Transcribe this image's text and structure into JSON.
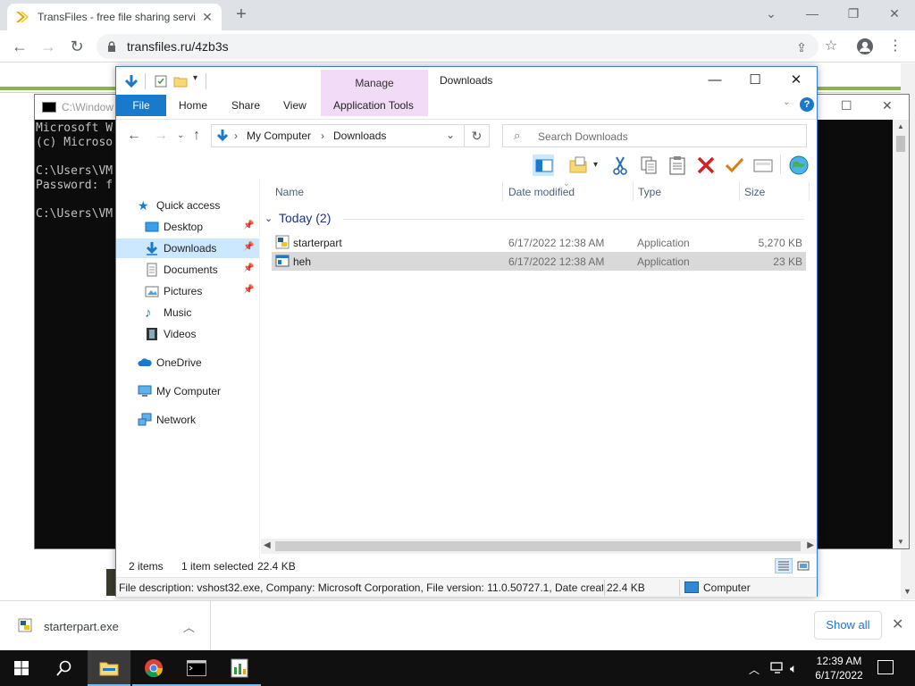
{
  "browser": {
    "tab_title": "TransFiles - free file sharing servi",
    "url": "transfiles.ru/4zb3s"
  },
  "cmd": {
    "title": "C:\\Window",
    "lines": [
      "Microsoft W",
      "(c) Microso",
      "",
      "C:\\Users\\VM",
      "Password: f",
      "",
      "C:\\Users\\VM"
    ]
  },
  "explorer": {
    "title": "Downloads",
    "manage_label": "Manage",
    "ribbon_tabs": {
      "file": "File",
      "home": "Home",
      "share": "Share",
      "view": "View",
      "app_tools": "Application Tools"
    },
    "breadcrumb": [
      "My Computer",
      "Downloads"
    ],
    "search_placeholder": "Search Downloads",
    "nav": [
      {
        "label": "Quick access",
        "icon": "star-icon"
      },
      {
        "label": "Desktop",
        "icon": "desktop-folder-icon",
        "pinned": true
      },
      {
        "label": "Downloads",
        "icon": "downloads-folder-icon",
        "pinned": true,
        "selected": true
      },
      {
        "label": "Documents",
        "icon": "documents-folder-icon",
        "pinned": true
      },
      {
        "label": "Pictures",
        "icon": "pictures-folder-icon",
        "pinned": true
      },
      {
        "label": "Music",
        "icon": "music-icon"
      },
      {
        "label": "Videos",
        "icon": "videos-icon"
      },
      {
        "label": "OneDrive",
        "icon": "cloud-icon"
      },
      {
        "label": "My Computer",
        "icon": "computer-icon"
      },
      {
        "label": "Network",
        "icon": "network-icon"
      }
    ],
    "columns": {
      "name": "Name",
      "date": "Date modified",
      "type": "Type",
      "size": "Size"
    },
    "group_label": "Today (2)",
    "files": [
      {
        "name": "starterpart",
        "date": "6/17/2022 12:38 AM",
        "type": "Application",
        "size": "5,270 KB",
        "selected": false
      },
      {
        "name": "heh",
        "date": "6/17/2022 12:38 AM",
        "type": "Application",
        "size": "23 KB",
        "selected": true
      }
    ],
    "status": {
      "items": "2 items",
      "selected": "1 item selected",
      "size": "22.4 KB"
    },
    "details": {
      "description": "File description: vshost32.exe, Company: Microsoft Corporation, File version: 11.0.50727.1, Date created:",
      "size": "22.4 KB",
      "location": "Computer"
    }
  },
  "downloads_shelf": {
    "file": "starterpart.exe",
    "show_all": "Show all"
  },
  "taskbar": {
    "time": "12:39 AM",
    "date": "6/17/2022"
  },
  "colors": {
    "accent": "#1979ca",
    "manage_bg": "#f1dbf7",
    "selection": "#cce8ff",
    "link_blue": "#1a73e8"
  }
}
